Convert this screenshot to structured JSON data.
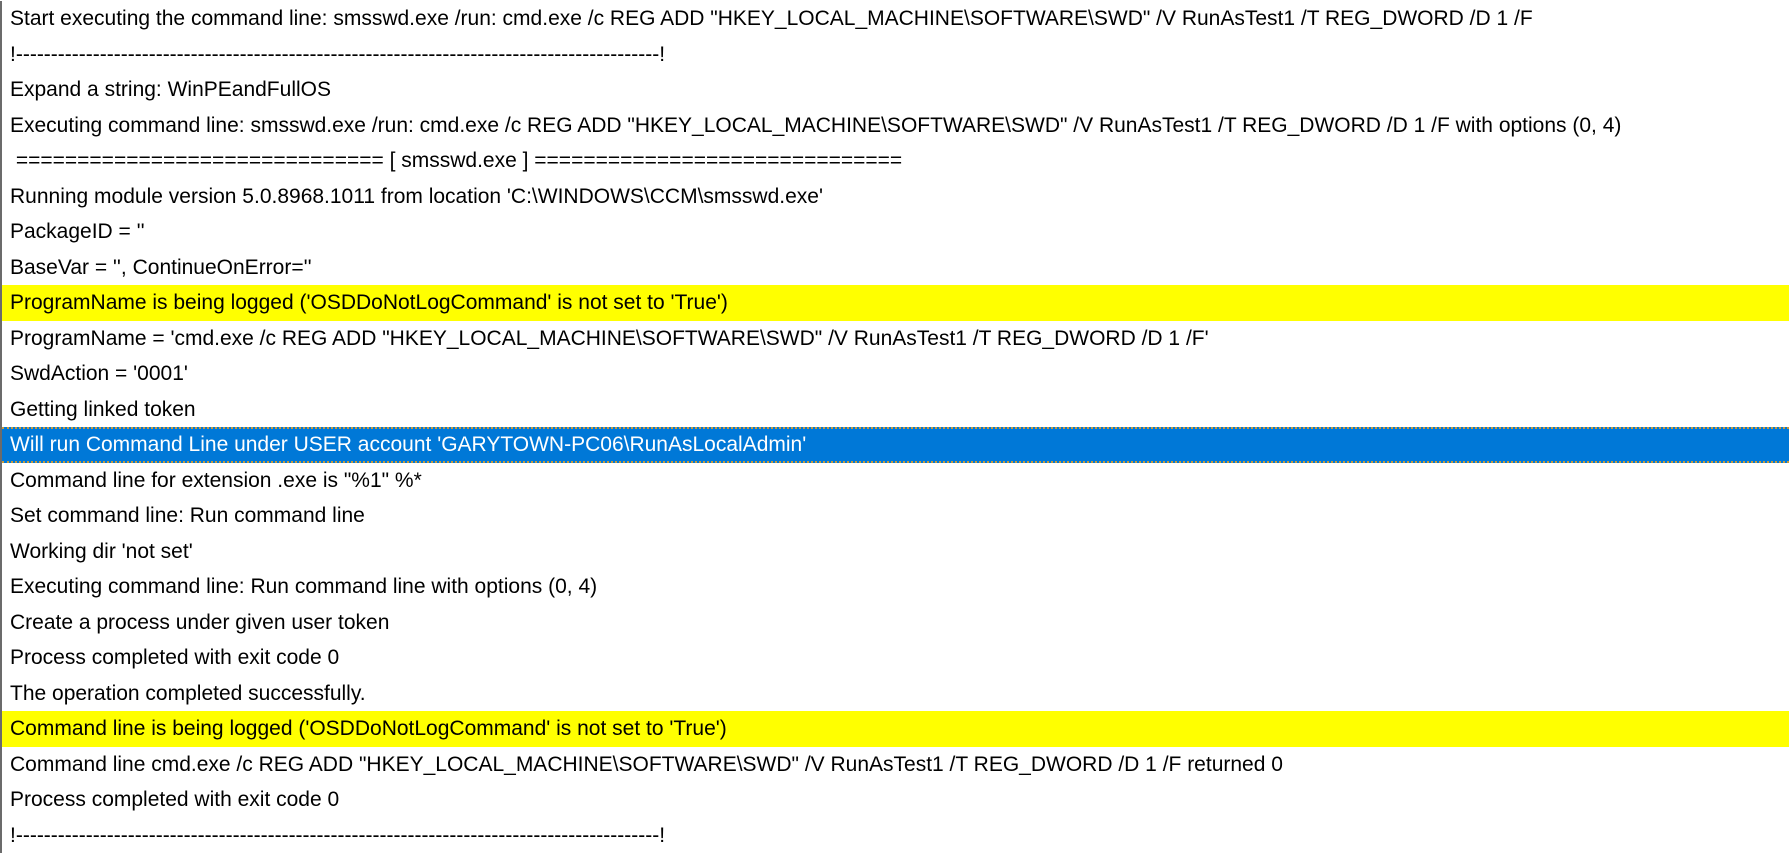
{
  "log": {
    "colors": {
      "highlight": "#ffff00",
      "selected": "#0078d7"
    },
    "rows": [
      {
        "text": "Start executing the command line: smsswd.exe /run: cmd.exe /c REG ADD \"HKEY_LOCAL_MACHINE\\SOFTWARE\\SWD\" /V RunAsTest1 /T REG_DWORD /D 1 /F",
        "style": ""
      },
      {
        "text": "!--------------------------------------------------------------------------------------------!",
        "style": ""
      },
      {
        "text": "Expand a string: WinPEandFullOS",
        "style": ""
      },
      {
        "text": "Executing command line: smsswd.exe /run: cmd.exe /c REG ADD \"HKEY_LOCAL_MACHINE\\SOFTWARE\\SWD\" /V RunAsTest1 /T REG_DWORD /D 1 /F with options (0, 4)",
        "style": ""
      },
      {
        "text": " ============================== [ smsswd.exe ] ==============================",
        "style": ""
      },
      {
        "text": "Running module version 5.0.8968.1011 from location 'C:\\WINDOWS\\CCM\\smsswd.exe'",
        "style": ""
      },
      {
        "text": "PackageID = ''",
        "style": ""
      },
      {
        "text": "BaseVar = '', ContinueOnError=''",
        "style": ""
      },
      {
        "text": "ProgramName is being logged ('OSDDoNotLogCommand' is not set to 'True')",
        "style": "yellow"
      },
      {
        "text": "ProgramName = 'cmd.exe /c REG ADD \"HKEY_LOCAL_MACHINE\\SOFTWARE\\SWD\" /V RunAsTest1 /T REG_DWORD /D 1 /F'",
        "style": ""
      },
      {
        "text": "SwdAction = '0001'",
        "style": ""
      },
      {
        "text": "Getting linked token",
        "style": ""
      },
      {
        "text": "Will run Command Line under USER account 'GARYTOWN-PC06\\RunAsLocalAdmin'",
        "style": "selected"
      },
      {
        "text": "Command line for extension .exe is \"%1\" %*",
        "style": ""
      },
      {
        "text": "Set command line: Run command line",
        "style": ""
      },
      {
        "text": "Working dir 'not set'",
        "style": ""
      },
      {
        "text": "Executing command line: Run command line with options (0, 4)",
        "style": ""
      },
      {
        "text": "Create a process under given user token",
        "style": ""
      },
      {
        "text": "Process completed with exit code 0",
        "style": ""
      },
      {
        "text": "The operation completed successfully.",
        "style": ""
      },
      {
        "text": "Command line is being logged ('OSDDoNotLogCommand' is not set to 'True')",
        "style": "yellow"
      },
      {
        "text": "Command line cmd.exe /c REG ADD \"HKEY_LOCAL_MACHINE\\SOFTWARE\\SWD\" /V RunAsTest1 /T REG_DWORD /D 1 /F returned 0",
        "style": ""
      },
      {
        "text": "Process completed with exit code 0",
        "style": ""
      },
      {
        "text": "!--------------------------------------------------------------------------------------------!",
        "style": ""
      }
    ]
  }
}
